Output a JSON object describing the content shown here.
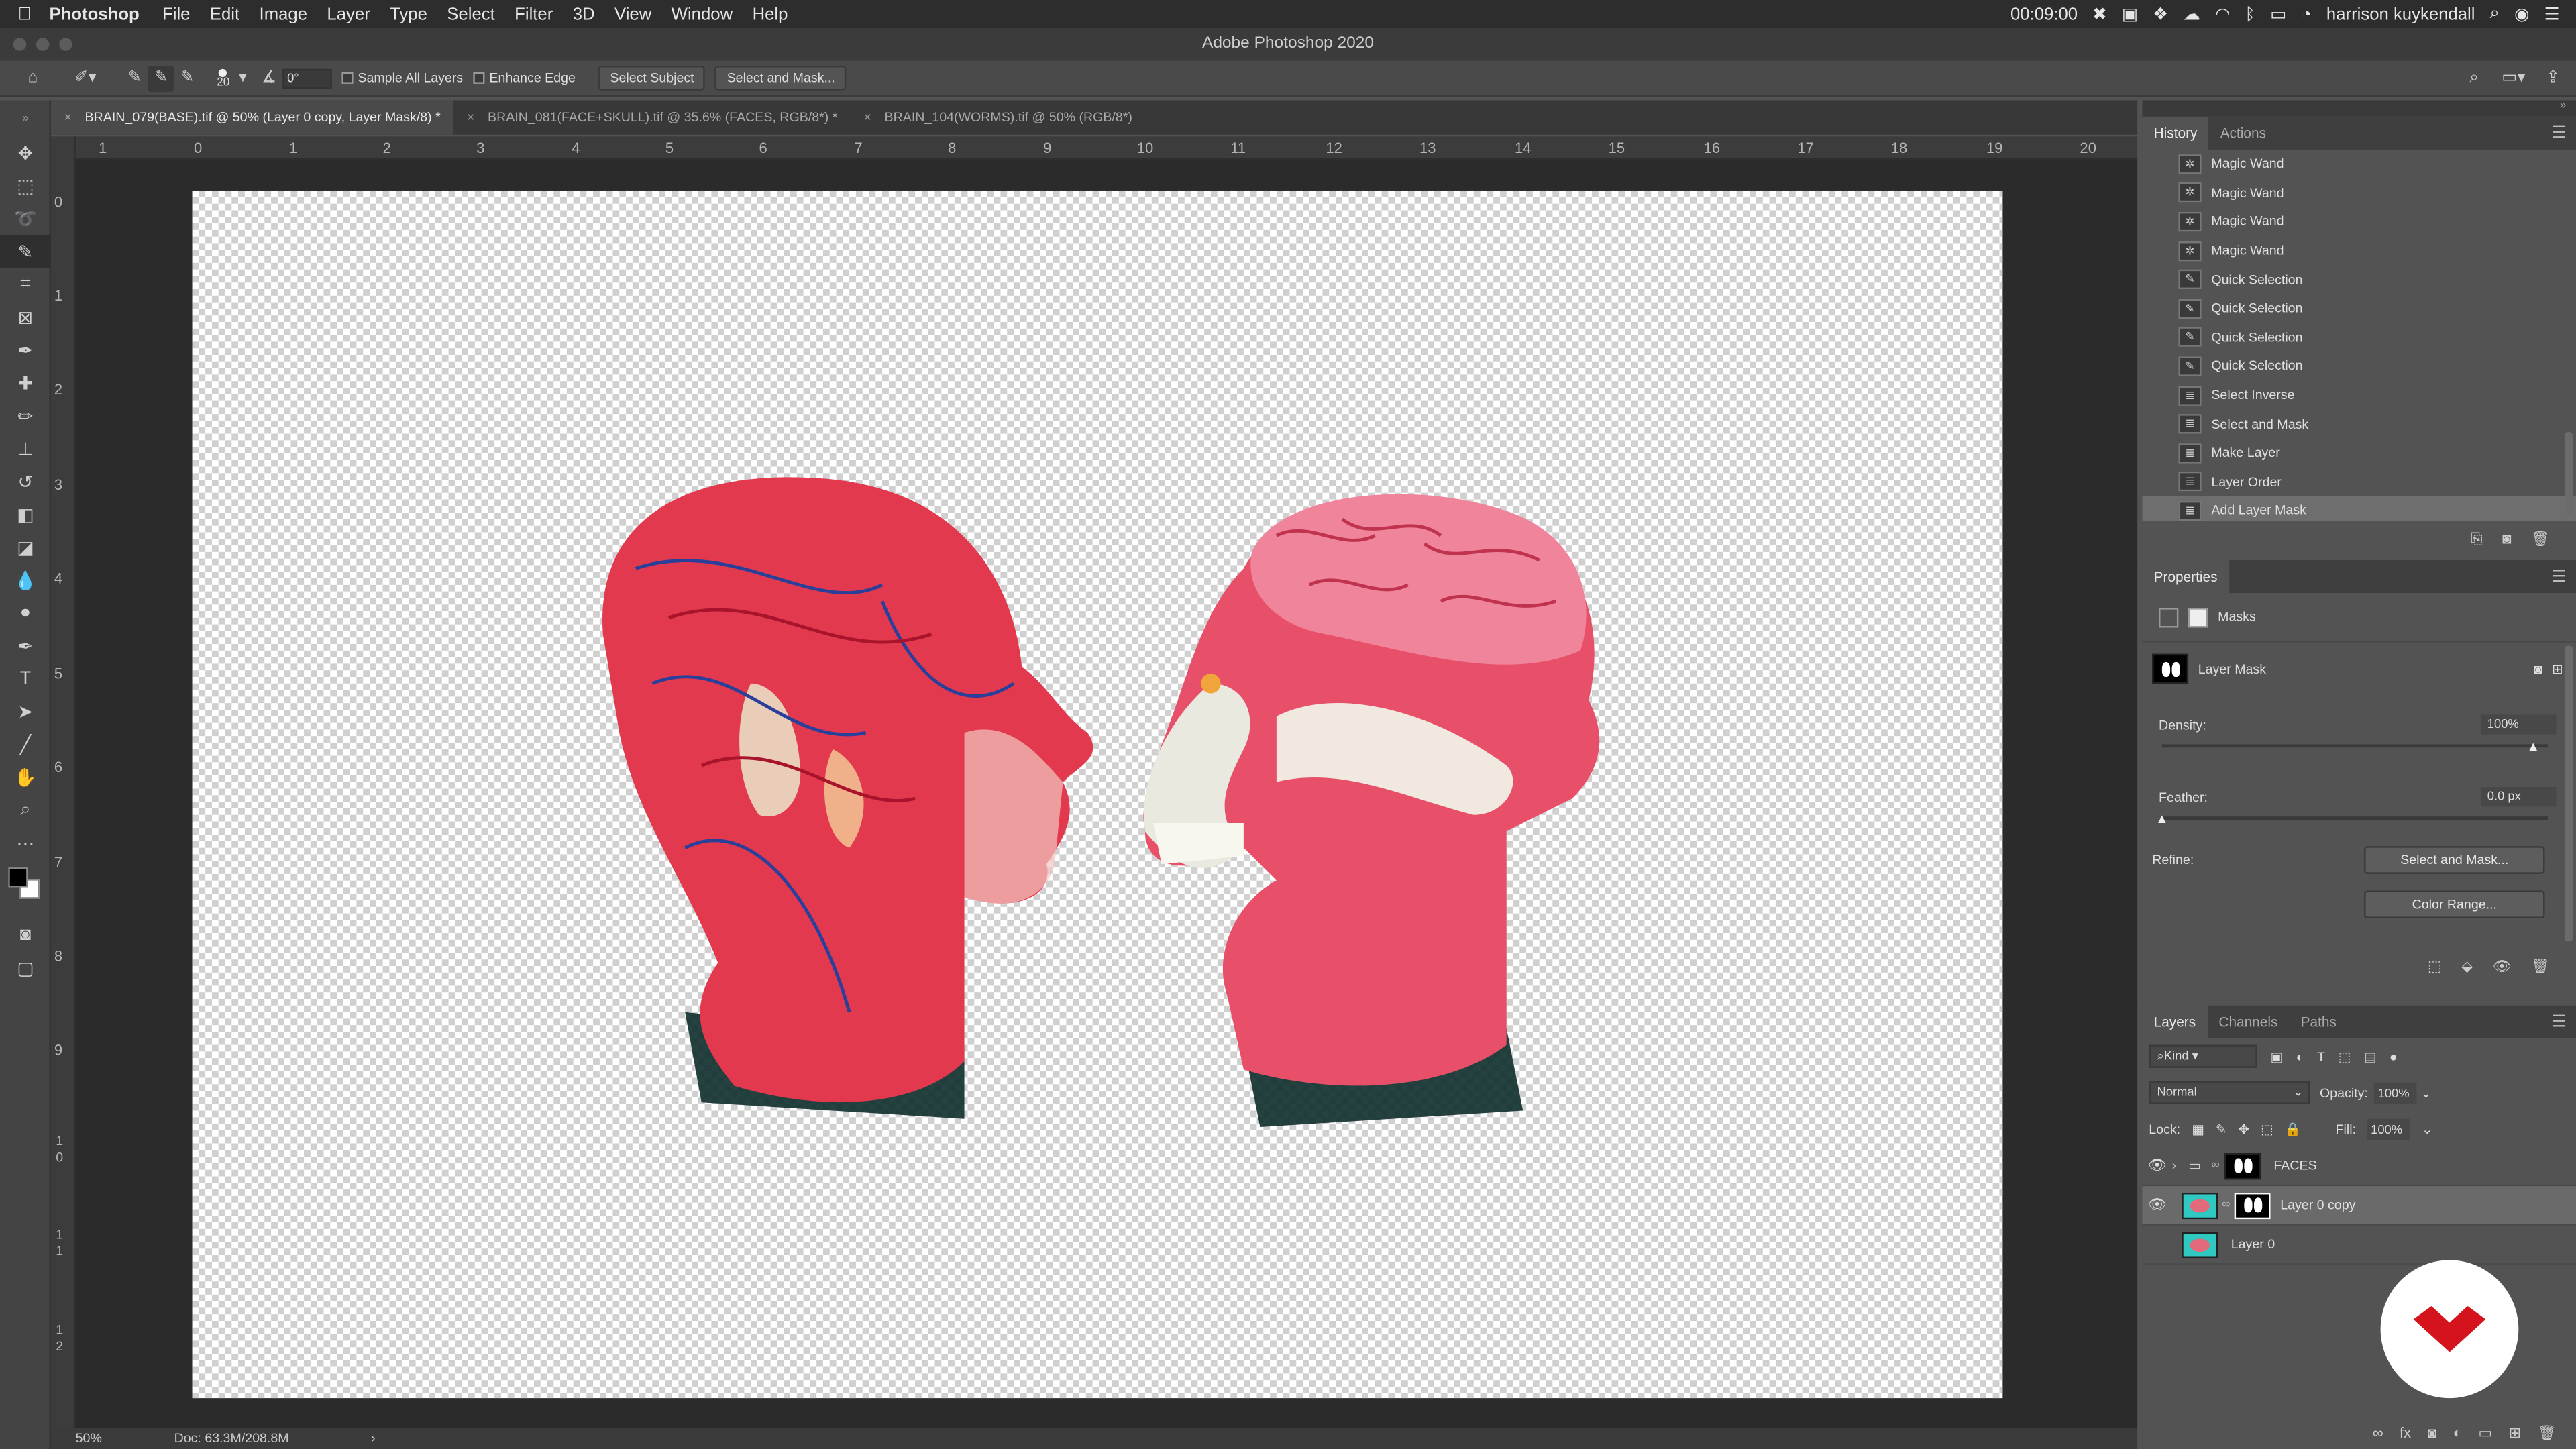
{
  "menubar": {
    "app_name": "Photoshop",
    "items": [
      "File",
      "Edit",
      "Image",
      "Layer",
      "Type",
      "Select",
      "Filter",
      "3D",
      "View",
      "Window",
      "Help"
    ],
    "clock": "00:09:00",
    "user": "harrison kuykendall"
  },
  "window": {
    "title": "Adobe Photoshop 2020"
  },
  "options": {
    "brush_size": "20",
    "angle": "0°",
    "sample_all_layers": "Sample All Layers",
    "enhance_edge": "Enhance Edge",
    "select_subject": "Select Subject",
    "select_and_mask": "Select and Mask..."
  },
  "tabs": [
    {
      "label": "BRAIN_079(BASE).tif @ 50% (Layer 0 copy, Layer Mask/8) *"
    },
    {
      "label": "BRAIN_081(FACE+SKULL).tif @ 35.6% (FACES, RGB/8*) *"
    },
    {
      "label": "BRAIN_104(WORMS).tif @ 50% (RGB/8*)"
    }
  ],
  "ruler": {
    "h": [
      "1",
      "0",
      "1",
      "2",
      "3",
      "4",
      "5",
      "6",
      "7",
      "8",
      "9",
      "10",
      "11",
      "12",
      "13",
      "14",
      "15",
      "16",
      "17",
      "18",
      "19",
      "20"
    ],
    "v": [
      "0",
      "1",
      "2",
      "3",
      "4",
      "5",
      "6",
      "7",
      "8",
      "9",
      "1 0",
      "1 1",
      "1 2"
    ]
  },
  "status": {
    "zoom": "50%",
    "doc": "Doc: 63.3M/208.8M"
  },
  "history": {
    "tab": "History",
    "tab2": "Actions",
    "items": [
      {
        "label": "Magic Wand"
      },
      {
        "label": "Magic Wand"
      },
      {
        "label": "Magic Wand"
      },
      {
        "label": "Magic Wand"
      },
      {
        "label": "Quick Selection"
      },
      {
        "label": "Quick Selection"
      },
      {
        "label": "Quick Selection"
      },
      {
        "label": "Quick Selection"
      },
      {
        "label": "Select Inverse"
      },
      {
        "label": "Select and Mask"
      },
      {
        "label": "Make Layer"
      },
      {
        "label": "Layer Order"
      },
      {
        "label": "Add Layer Mask"
      }
    ]
  },
  "properties": {
    "title": "Properties",
    "masks": "Masks",
    "layer_mask": "Layer Mask",
    "density_label": "Density:",
    "density_value": "100%",
    "feather_label": "Feather:",
    "feather_value": "0.0 px",
    "refine_label": "Refine:",
    "select_and_mask_btn": "Select and Mask...",
    "color_range_btn": "Color Range..."
  },
  "layers": {
    "tabs": [
      "Layers",
      "Channels",
      "Paths"
    ],
    "kind": "Kind",
    "blend_mode": "Normal",
    "opacity_label": "Opacity:",
    "opacity_value": "100%",
    "lock_label": "Lock:",
    "fill_label": "Fill:",
    "fill_value": "100%",
    "items": [
      {
        "name": "FACES"
      },
      {
        "name": "Layer 0 copy"
      },
      {
        "name": "Layer 0"
      }
    ]
  }
}
